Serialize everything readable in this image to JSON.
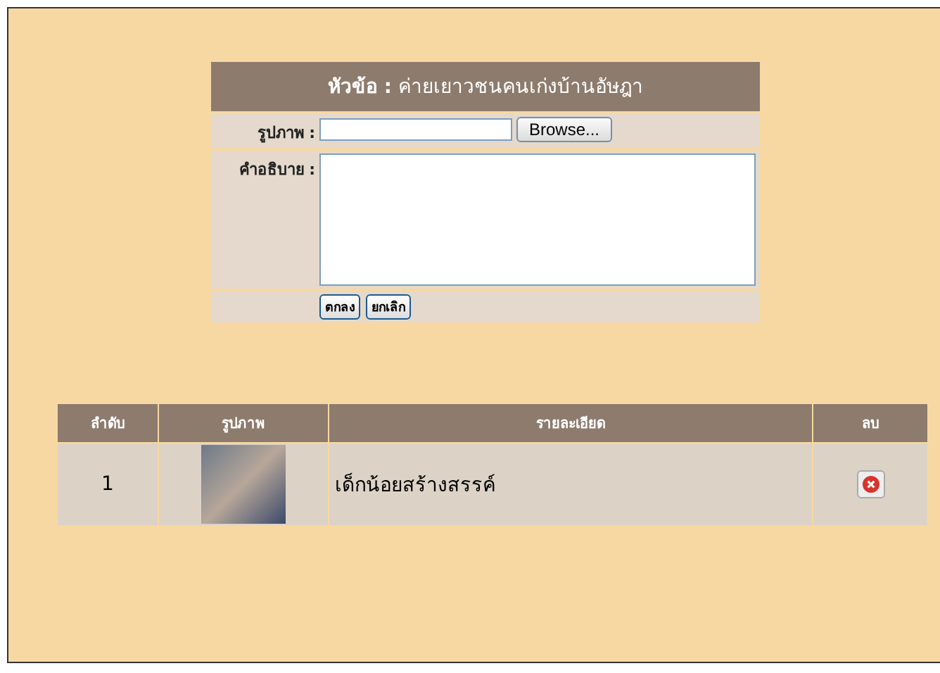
{
  "form": {
    "title": "**หัวข้อ :** ค่ายเยาวชนคนเก่งบ้านอัษฎา",
    "fields": [
      {
        "kind": "file",
        "label": "รูปภาพ :",
        "button": "Browse..."
      },
      {
        "kind": "textarea",
        "label": "คำอธิบาย :"
      }
    ],
    "buttons": [
      "ตกลง",
      "ยกเลิก"
    ]
  },
  "table": {
    "columns": [
      "ลำดับ",
      "รูปภาพ",
      "รายละเอียด",
      "ลบ"
    ],
    "rows": [
      {
        "number": "1",
        "detail": "เด็กน้อยสร้างสรรค์"
      }
    ]
  }
}
